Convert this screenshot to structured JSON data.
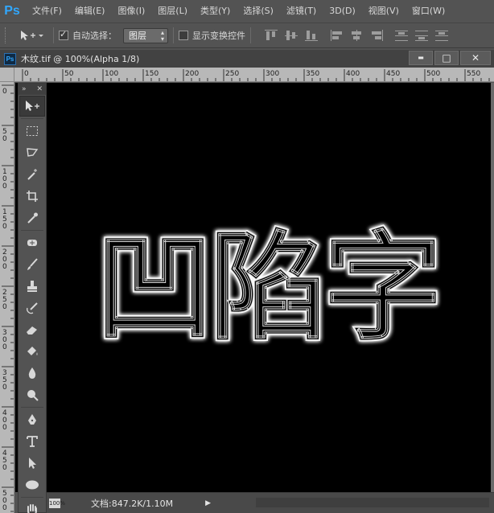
{
  "app": {
    "logo": "Ps"
  },
  "menu": [
    "文件(F)",
    "编辑(E)",
    "图像(I)",
    "图层(L)",
    "类型(Y)",
    "选择(S)",
    "滤镜(T)",
    "3D(D)",
    "视图(V)",
    "窗口(W)"
  ],
  "options": {
    "auto_select_label": "自动选择：",
    "auto_select_checked": true,
    "auto_select_value": "图层",
    "show_transform_label": "显示变换控件",
    "show_transform_checked": false
  },
  "document": {
    "title": "木纹.tif @ 100%(Alpha 1/8)",
    "minimize": "▬",
    "restore": "□",
    "close": "✕"
  },
  "ruler": {
    "top_labels": [
      "0",
      "50",
      "100",
      "150",
      "200",
      "250",
      "300",
      "350",
      "400",
      "450",
      "500",
      "550"
    ],
    "left_labels": [
      "0",
      "50",
      "100",
      "150",
      "200",
      "250",
      "300",
      "350",
      "400",
      "450",
      "500"
    ]
  },
  "canvas": {
    "text": "凹陷字",
    "glow_color": "#ffffff",
    "background": "#000000"
  },
  "status": {
    "zoom": "100%",
    "doc_info": "文档:847.2K/1.10M",
    "arrow": "▶"
  },
  "toolbox": {
    "head_left": "»",
    "head_right": "✕",
    "tools": [
      "move-icon",
      "marquee-icon",
      "lasso-icon",
      "magic-wand-icon",
      "crop-icon",
      "eyedropper-icon",
      "healing-brush-icon",
      "brush-icon",
      "clone-stamp-icon",
      "history-brush-icon",
      "eraser-icon",
      "paint-bucket-icon",
      "blur-icon",
      "dodge-icon",
      "pen-icon",
      "type-icon",
      "path-selection-icon",
      "ellipse-icon",
      "hand-icon"
    ]
  },
  "colors": {
    "ui_bg": "#535353",
    "accent": "#31a8ff"
  }
}
